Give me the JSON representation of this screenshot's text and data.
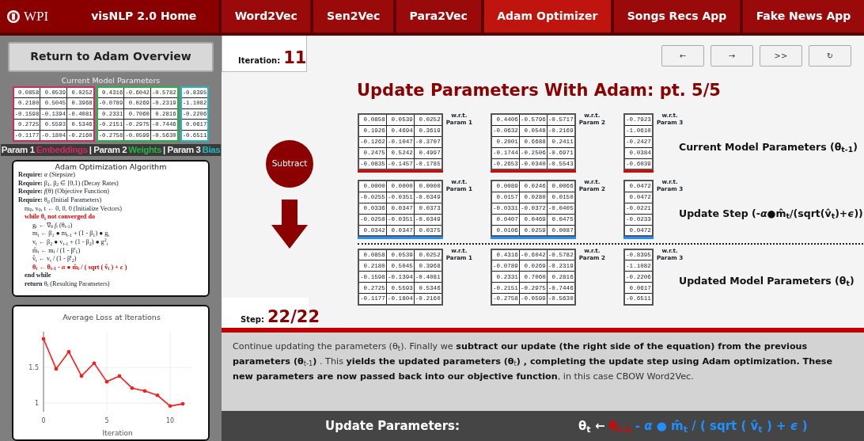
{
  "nav": {
    "logo": "WPI",
    "home": "visNLP 2.0 Home",
    "tabs": [
      {
        "label": "Word2Vec",
        "selected": false
      },
      {
        "label": "Sen2Vec",
        "selected": false
      },
      {
        "label": "Para2Vec",
        "selected": false
      },
      {
        "label": "Adam Optimizer",
        "selected": true
      },
      {
        "label": "Songs Recs App",
        "selected": false
      },
      {
        "label": "Fake News App",
        "selected": false
      }
    ]
  },
  "sidebar": {
    "return_button": "Return to Adam Overview",
    "current_params": {
      "title": "Current Model Parameters",
      "matrices": [
        {
          "color": "#d42a5c",
          "rows": [
            [
              "0.0858",
              "0.0539",
              "0.0252"
            ],
            [
              "0.2180",
              "0.5045",
              "0.3968"
            ],
            [
              "-0.1598",
              "-0.1394",
              "-0.4081"
            ],
            [
              "0.2725",
              "0.5593",
              "0.5346"
            ],
            [
              "-0.1177",
              "-0.1804",
              "-0.2160"
            ]
          ]
        },
        {
          "color": "#26b444",
          "rows": [
            [
              "0.4316",
              "-0.6042",
              "-0.5782"
            ],
            [
              "-0.0789",
              "0.0269",
              "-0.2319"
            ],
            [
              "0.2331",
              "0.7060",
              "0.2816"
            ],
            [
              "-0.2151",
              "-0.2975",
              "-0.7446"
            ],
            [
              "-0.2758",
              "-0.0599",
              "-0.5630"
            ]
          ]
        },
        {
          "color": "#22b8c0",
          "rows": [
            [
              "-0.8395"
            ],
            [
              "-1.1082"
            ],
            [
              "-0.2206"
            ],
            [
              "0.0617"
            ],
            [
              "-0.6511"
            ]
          ]
        }
      ],
      "legend": [
        {
          "label": "Param 1",
          "name": "Embeddings"
        },
        {
          "label": "| Param 2",
          "name": "Weights"
        },
        {
          "label": "| Param 3",
          "name": "Bias"
        }
      ]
    },
    "algorithm": {
      "title": "Adam Optimization Algorithm",
      "lines": [
        {
          "kind": "require",
          "highlight": false,
          "text": "**Require:** *α*  (Stepsize)"
        },
        {
          "kind": "require",
          "highlight": false,
          "text": "**Require:** β$_{1}$, β$_{2}$ ∈ [0,1)  (Decay Rates)"
        },
        {
          "kind": "require",
          "highlight": false,
          "text": "**Require:** *f*(θ)  (Objective Function)"
        },
        {
          "kind": "require",
          "highlight": false,
          "text": "**Require:** θ$_{0}$  (Initial Parameters)"
        },
        {
          "kind": "step",
          "highlight": false,
          "text": "m$_{0}$, v$_{0}$, t ← 0, 0, 0  (Initialize Vectors)"
        },
        {
          "kind": "step",
          "highlight": true,
          "text": "while θ$_{t}$ not converged do",
          "children": [
            {
              "kind": "step",
              "highlight": false,
              "text": "g$_{t}$ ← ∇$_{θ}$ *f*$_{t}$ (θ$_{t-1}$)"
            },
            {
              "kind": "step",
              "highlight": false,
              "text": "m$_{t}$ ← β$_{1}$ ● m$_{t-1}$ + (1 - β$_{1}$) ● g$_{t}$"
            },
            {
              "kind": "step",
              "highlight": false,
              "text": "v$_{t}$ ← β$_{2}$ ● v$_{t-1}$ + (1 - β$_{2}$) ● g$^{2}$$_{t}$"
            },
            {
              "kind": "step",
              "highlight": false,
              "text": "m̂$_{t}$ ← m$_{t}$ / (1 - β$^{t}$$_{1}$)"
            },
            {
              "kind": "step",
              "highlight": false,
              "text": "v̂$_{t}$ ← v$_{t}$ / (1 - β$^{t}$$_{2}$)"
            },
            {
              "kind": "step",
              "highlight": true,
              "text": "θ$_{t}$ ← θ$_{t-1}$ - *α* ● m̂$_{t}$ / ( sqrt ( v̂$_{t}$ ) + *ϵ* )"
            }
          ]
        },
        {
          "kind": "step",
          "highlight": false,
          "text": "**end while**"
        },
        {
          "kind": "step",
          "highlight": false,
          "text": "**return** θ$_{t}$  (Resulting Parameters)"
        }
      ]
    },
    "loss_chart": {
      "chart_data": {
        "type": "line",
        "title": "Average Loss at Iterations",
        "xlabel": "Iteration",
        "x": [
          0,
          1,
          2,
          3,
          4,
          5,
          6,
          7,
          8,
          9,
          10,
          11
        ],
        "grid": true,
        "series": [
          {
            "color": "#ff1a1a",
            "values": [
              1.9,
              1.48,
              1.72,
              1.38,
              1.56,
              1.3,
              1.38,
              1.21,
              1.17,
              1.11,
              0.96,
              0.99
            ]
          }
        ],
        "xlim": [
          0,
          11.7
        ],
        "ylim": [
          0.88,
          2.0
        ],
        "xticks": [
          0,
          5,
          10
        ],
        "yticks": [
          1,
          1.5
        ]
      }
    }
  },
  "main": {
    "iteration": {
      "label": "Iteration:",
      "value": "11"
    },
    "controls": [
      "←",
      "→",
      ">>",
      "↻"
    ],
    "title": "Update Parameters With Adam: pt. 5/5",
    "operation": "Subtract",
    "groups": [
      {
        "label": "Current Model Parameters (θ$_{t-1}$)",
        "color": "#e00000",
        "matrices": [
          {
            "wrt": "w.r.t.",
            "param": "Param 1",
            "rows": [
              [
                "0.0858",
                "0.0539",
                "0.0252"
              ],
              [
                "0.1926",
                "0.4694",
                "0.3619"
              ],
              [
                "-0.1262",
                "-0.1047",
                "-0.3707"
              ],
              [
                "0.2475",
                "0.5242",
                "0.4997"
              ],
              [
                "-0.0835",
                "-0.1457",
                "-0.1785"
              ]
            ]
          },
          {
            "wrt": "w.r.t.",
            "param": "Param 2",
            "rows": [
              [
                "0.4406",
                "-0.5796",
                "-0.5717"
              ],
              [
                "-0.0632",
                "0.0548",
                "-0.2169"
              ],
              [
                "0.2001",
                "0.6688",
                "0.2411"
              ],
              [
                "-0.1744",
                "-0.2506",
                "-0.6971"
              ],
              [
                "-0.2653",
                "-0.0340",
                "-0.5543"
              ]
            ]
          },
          {
            "wrt": "w.r.t.",
            "param": "Param 3",
            "rows": [
              [
                "-0.7923"
              ],
              [
                "-1.0610"
              ],
              [
                "-0.2427"
              ],
              [
                "0.0384"
              ],
              [
                "-0.6039"
              ]
            ]
          }
        ]
      },
      {
        "label": "Update Step (-*α*●m̂$_{t}$/(sqrt(v̂$_{t}$)+*ϵ*))",
        "color": "#1e90ff",
        "matrices": [
          {
            "wrt": "w.r.t.",
            "param": "Param 1",
            "rows": [
              [
                "0.0000",
                "0.0000",
                "0.0000"
              ],
              [
                "-0.0255",
                "-0.0351",
                "-0.0349"
              ],
              [
                "0.0336",
                "0.0347",
                "0.0373"
              ],
              [
                "-0.0250",
                "-0.0351",
                "-0.0349"
              ],
              [
                "0.0342",
                "0.0347",
                "0.0375"
              ]
            ]
          },
          {
            "wrt": "w.r.t.",
            "param": "Param 2",
            "rows": [
              [
                "0.0089",
                "0.0246",
                "0.0066"
              ],
              [
                "0.0157",
                "0.0280",
                "0.0150"
              ],
              [
                "-0.0331",
                "-0.0372",
                "-0.0405"
              ],
              [
                "0.0407",
                "0.0469",
                "0.0475"
              ],
              [
                "0.0106",
                "0.0259",
                "0.0087"
              ]
            ]
          },
          {
            "wrt": "w.r.t.",
            "param": "Param 3",
            "rows": [
              [
                "0.0472"
              ],
              [
                "0.0472"
              ],
              [
                "-0.0221"
              ],
              [
                "-0.0233"
              ],
              [
                "0.0472"
              ]
            ]
          }
        ]
      },
      {
        "label": "Updated Model Parameters (θ$_{t}$)",
        "matrices": [
          {
            "wrt": "w.r.t.",
            "param": "Param 1",
            "rows": [
              [
                "0.0858",
                "0.0539",
                "0.0252"
              ],
              [
                "0.2180",
                "0.5045",
                "0.3968"
              ],
              [
                "-0.1598",
                "-0.1394",
                "-0.4081"
              ],
              [
                "0.2725",
                "0.5593",
                "0.5346"
              ],
              [
                "-0.1177",
                "-0.1804",
                "-0.2160"
              ]
            ]
          },
          {
            "wrt": "w.r.t.",
            "param": "Param 2",
            "rows": [
              [
                "0.4316",
                "-0.6042",
                "-0.5782"
              ],
              [
                "-0.0789",
                "0.0269",
                "-0.2319"
              ],
              [
                "0.2331",
                "0.7060",
                "0.2816"
              ],
              [
                "-0.2151",
                "-0.2975",
                "-0.7446"
              ],
              [
                "-0.2758",
                "-0.0599",
                "-0.5630"
              ]
            ]
          },
          {
            "wrt": "w.r.t.",
            "param": "Param 3",
            "rows": [
              [
                "-0.8395"
              ],
              [
                "-1.1082"
              ],
              [
                "-0.2206"
              ],
              [
                "0.0617"
              ],
              [
                "-0.6511"
              ]
            ]
          }
        ]
      }
    ],
    "step": {
      "label": "Step:",
      "value": "22/22"
    },
    "description": "Continue updating the parameters (θ$_{t}$). Finally we **subtract our update (the right side of the equation) from the previous parameters (θ**$_{t-1}$**)** . This **yields the updated parameters (θ**$_{t}$**) , completing the update step using Adam optimization. These new parameters are now passed back into our objective function**, in this case CBOW Word2Vec.",
    "footer": {
      "label": "Update Parameters:",
      "formula": [
        {
          "text": "θ$_{t}$ ←",
          "color": "#ffffff"
        },
        {
          "text": "θ$_{t-1}$",
          "color": "#e00000"
        },
        {
          "text": "- *α* ● m̂$_{t}$ / ( sqrt ( v̂$_{t}$ ) + *ϵ* )",
          "color": "#1e90ff"
        }
      ]
    }
  }
}
